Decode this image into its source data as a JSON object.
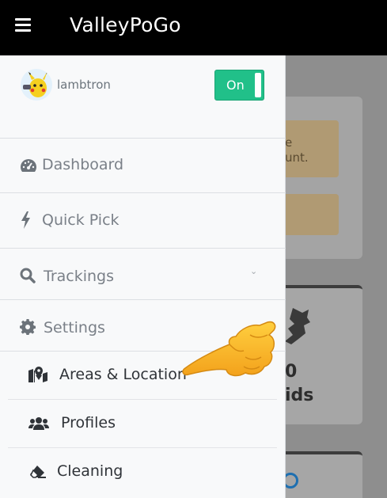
{
  "app": {
    "title": "ValleyPoGo"
  },
  "icons": {
    "menu": "hamburger-icon",
    "dashboard": "tachometer-icon",
    "quick_pick": "bolt-icon",
    "trackings": "search-icon",
    "settings": "gear-icon",
    "areas": "map-marker-icon",
    "profiles": "users-icon",
    "cleaning": "eraser-icon"
  },
  "user": {
    "name": "lambtron",
    "toggle_label": "On"
  },
  "nav": {
    "dashboard": "Dashboard",
    "quick_pick": "Quick Pick",
    "trackings": "Trackings",
    "trackings_chevron": "⌄",
    "settings": "Settings"
  },
  "settings_menu": {
    "areas": "Areas & Location",
    "profiles": "Profiles",
    "cleaning": "Cleaning"
  },
  "background": {
    "alert_text_1": "e",
    "alert_text_2": "unt.",
    "card_line_1": "0",
    "card_line_2": "ids"
  },
  "colors": {
    "toggle_on": "#21c089",
    "topbar": "#000000",
    "drawer": "#f8f9fa"
  }
}
